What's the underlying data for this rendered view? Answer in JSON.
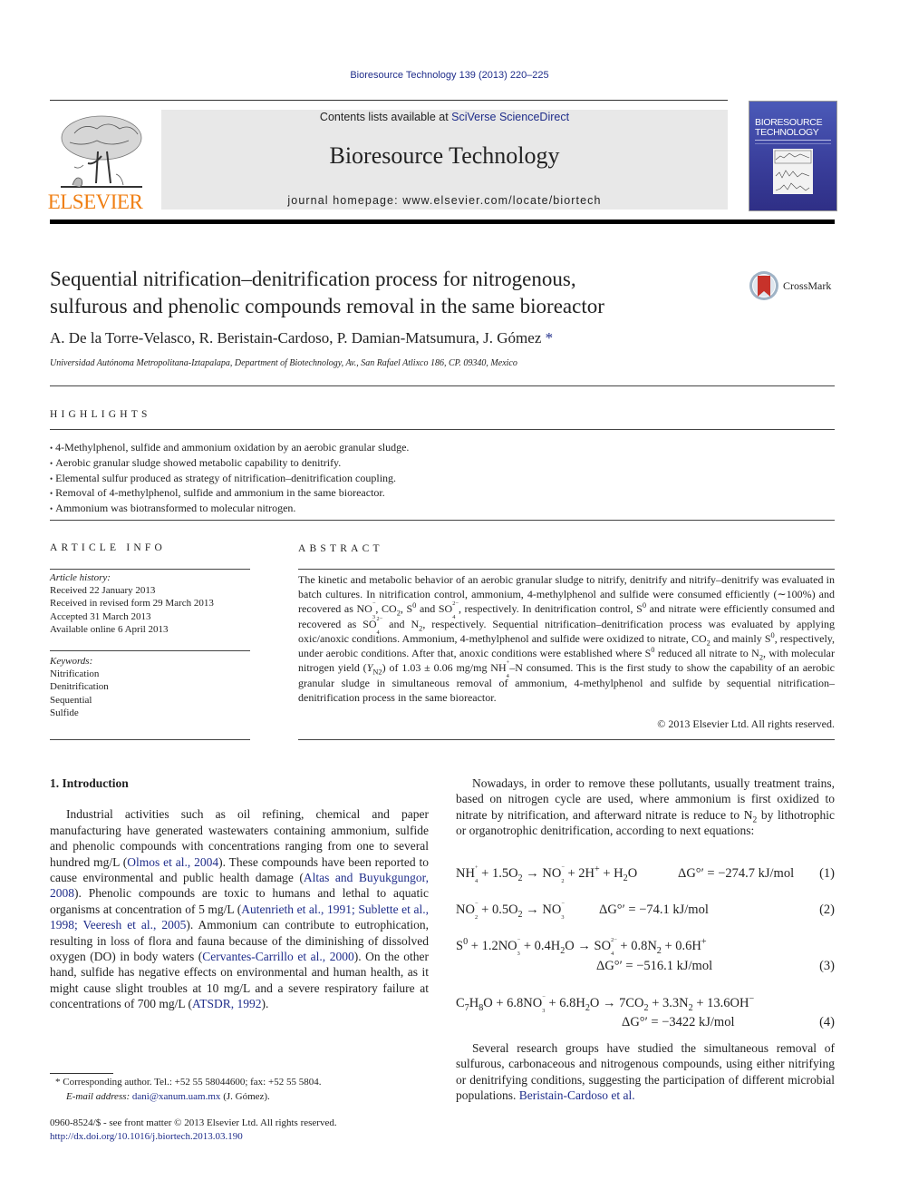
{
  "header": {
    "citation": "Bioresource Technology 139 (2013) 220–225",
    "contents_prefix": "Contents lists available at ",
    "contents_link": "SciVerse ScienceDirect",
    "journal_name": "Bioresource Technology",
    "homepage": "journal homepage: www.elsevier.com/locate/biortech",
    "publisher_logo_text": "ELSEVIER",
    "cover_title_line1": "BIORESOURCE",
    "cover_title_line2": "TECHNOLOGY",
    "brand_color": "#f07f13",
    "link_color": "#1f2d8a"
  },
  "article": {
    "title_line1": "Sequential nitrification–denitrification process for nitrogenous,",
    "title_line2": "sulfurous and phenolic compounds removal in the same bioreactor",
    "crossmark_label": "CrossMark",
    "authors": "A. De la Torre-Velasco, R. Beristain-Cardoso, P. Damian-Matsumura, J. Gómez",
    "author_marker": "*",
    "affiliation": "Universidad Autónoma Metropolitana-Iztapalapa, Department of Biotechnology, Av., San Rafael Atlixco 186, CP. 09340, Mexico"
  },
  "highlights": {
    "heading": "HIGHLIGHTS",
    "items": [
      "4-Methylphenol, sulfide and ammonium oxidation by an aerobic granular sludge.",
      "Aerobic granular sludge showed metabolic capability to denitrify.",
      "Elemental sulfur produced as strategy of nitrification–denitrification coupling.",
      "Removal of 4-methylphenol, sulfide and ammonium in the same bioreactor.",
      "Ammonium was biotransformed to molecular nitrogen."
    ]
  },
  "article_info": {
    "heading": "ARTICLE INFO",
    "history_label": "Article history:",
    "history": [
      "Received 22 January 2013",
      "Received in revised form 29 March 2013",
      "Accepted 31 March 2013",
      "Available online 6 April 2013"
    ],
    "keywords_label": "Keywords:",
    "keywords": [
      "Nitrification",
      "Denitrification",
      "Sequential",
      "Sulfide"
    ]
  },
  "abstract": {
    "heading": "ABSTRACT",
    "s1": "The kinetic and metabolic behavior of an aerobic granular sludge to nitrify, denitrify and nitrify–denitrify was evaluated in batch cultures. In nitrification control, ammonium, 4-methylphenol and sulfide were consumed efficiently (∼100%) and recovered as NO",
    "s2": ", CO",
    "s3": ", S",
    "s4": " and SO",
    "s5": ", respectively. In denitrification control, S",
    "s6": " and nitrate were efficiently consumed and recovered as SO",
    "s7": " and N",
    "s8": ", respectively. Sequential nitrification–denitrification process was evaluated by applying oxic/anoxic conditions. Ammonium, 4-methylphenol and sulfide were oxidized to nitrate, CO",
    "s9": " and mainly S",
    "s10": ", respectively, under aerobic conditions. After that, anoxic conditions were established where S",
    "s11": " reduced all nitrate to N",
    "s12": ", with molecular nitrogen yield (",
    "y_symbol": "Y",
    "y_sub": "N2",
    "s13": ") of 1.03 ± 0.06 mg/mg NH",
    "s14": "–N consumed. This is the first study to show the capability of an aerobic granular sludge in simultaneous removal of ammonium, 4-methylphenol and sulfide by sequential nitrification–denitrification process in the same bioreactor.",
    "copyright": "© 2013 Elsevier Ltd. All rights reserved."
  },
  "introduction": {
    "heading": "1. Introduction",
    "p1_a": "Industrial activities such as oil refining, chemical and paper manufacturing have generated wastewaters containing ammonium, sulfide and phenolic compounds with concentrations ranging from one to several hundred mg/L (",
    "ref1": "Olmos et al., 2004",
    "p1_b": "). These compounds have been reported to cause environmental and public health damage (",
    "ref2": "Altas and Buyukgungor, 2008",
    "p1_c": "). Phenolic compounds are toxic to humans and lethal to aquatic organisms at concentration of 5 mg/L (",
    "ref3": "Autenrieth et al., 1991; Sublette et al., 1998; Veeresh et al., 2005",
    "p1_d": "). Ammonium can contribute to eutrophication, resulting in loss of flora and fauna because of the diminishing of dissolved oxygen (DO) in body waters (",
    "ref4": "Cervantes-Carrillo et al., 2000",
    "p1_e": "). On the other hand, sulfide has negative effects on environmental and human health, as it might cause slight troubles at 10 mg/L and a severe respiratory failure at concentrations of 700 mg/L (",
    "ref5": "ATSDR, 1992",
    "p1_f": ").",
    "p2_a": "Nowadays, in order to remove these pollutants, usually treatment trains, based on nitrogen cycle are used, where ammonium is first oxidized to nitrate by nitrification, and afterward nitrate is reduce to N",
    "p2_b": " by lithotrophic or organotrophic denitrification, according to next equations:",
    "p3": "Several research groups have studied the simultaneous removal of sulfurous, carbonaceous and nitrogenous compounds, using either nitrifying or denitrifying conditions, suggesting the participation of different microbial populations. ",
    "ref6": "Beristain-Cardoso et al."
  },
  "equations": [
    {
      "number": "(1)",
      "dg": "ΔG°′ = −274.7 kJ/mol"
    },
    {
      "number": "(2)",
      "dg": "ΔG°′ = −74.1 kJ/mol"
    },
    {
      "number": "(3)",
      "dg": "ΔG°′ = −516.1 kJ/mol"
    },
    {
      "number": "(4)",
      "dg": "ΔG°′ = −3422 kJ/mol"
    }
  ],
  "footnote": {
    "corresponding": "* Corresponding author. Tel.: +52 55 58044600; fax: +52 55 5804.",
    "email_label": "E-mail address: ",
    "email": "dani@xanum.uam.mx",
    "email_suffix": " (J. Gómez).",
    "issn": "0960-8524/$ - see front matter © 2013 Elsevier Ltd. All rights reserved.",
    "doi": "http://dx.doi.org/10.1016/j.biortech.2013.03.190"
  }
}
